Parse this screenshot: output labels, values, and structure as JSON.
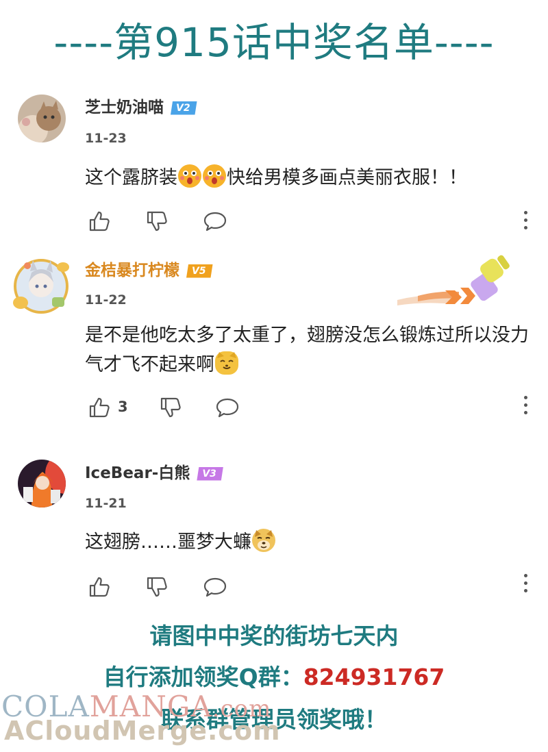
{
  "header": {
    "title": "----第915话中奖名单----"
  },
  "comments": [
    {
      "username": "芝士奶油喵",
      "level": "V2",
      "date": "11-23",
      "text_a": "这个露脐装",
      "text_b": "快给男模多画点美丽衣服！！",
      "emojis": [
        "shocked-face-emoji",
        "shocked-face-emoji"
      ],
      "likes": ""
    },
    {
      "username": "金桔暴打柠檬",
      "level": "V5",
      "date": "11-22",
      "text_a": "是不是他吃太多了太重了，翅膀没怎么锻炼过所以没力气才飞不起来啊",
      "emojis": [
        "cat-face-emoji"
      ],
      "likes": "3",
      "decoration": "paintbrush-decoration"
    },
    {
      "username": "IceBear-白熊",
      "level": "V3",
      "date": "11-21",
      "text_a": "这翅膀……噩梦大蠊",
      "emojis": [
        "dog-face-emoji"
      ],
      "likes": ""
    }
  ],
  "footer": {
    "line1": "请图中中奖的街坊七天内",
    "line2_label": "自行添加领奖Q群：",
    "line2_number": "824931767",
    "line3": "联系群管理员领奖哦！"
  },
  "watermark": {
    "part1": "COLA",
    "part2": "MANGA",
    "part3": ".com",
    "line2": "ACloudMerge.com"
  },
  "colors": {
    "accent": "#1f7b80",
    "gold_name": "#d9881f",
    "group_number": "#cc2a24",
    "badge_v2": "#4aa3e8",
    "badge_v5": "#f0a11e",
    "badge_v3": "#c678e6"
  },
  "icons": [
    "thumbs-up-icon",
    "thumbs-down-icon",
    "comment-bubble-icon",
    "more-vertical-icon"
  ]
}
